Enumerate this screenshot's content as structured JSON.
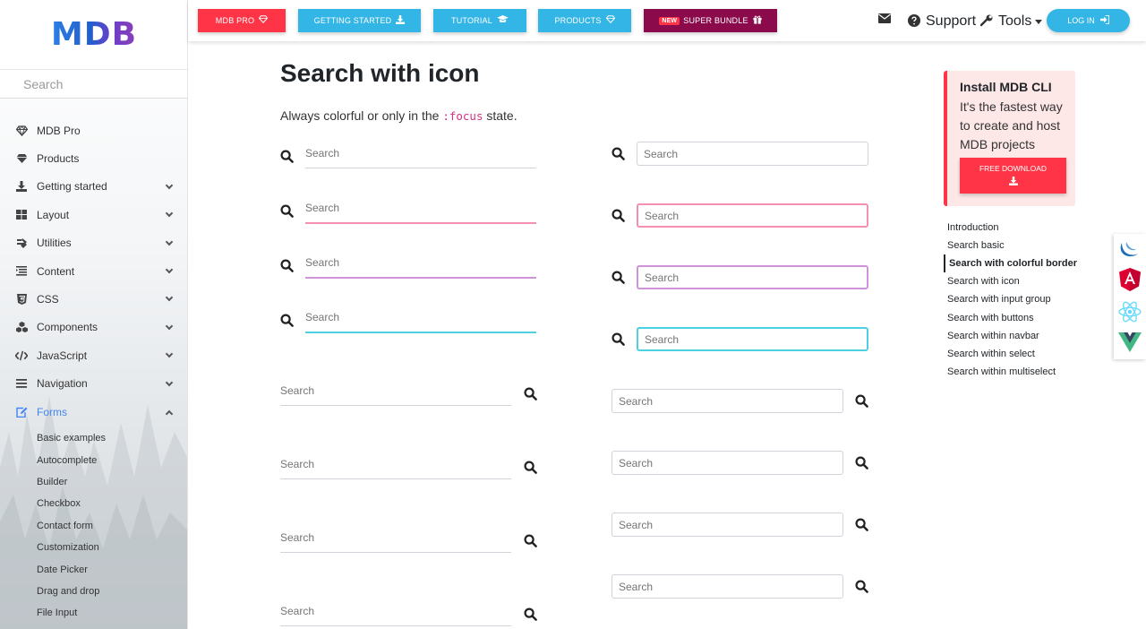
{
  "sidebar": {
    "logo": "MDB",
    "search_placeholder": "Search",
    "items": [
      {
        "label": "MDB Pro",
        "icon": "gem-icon",
        "chevron": false
      },
      {
        "label": "Products",
        "icon": "gem-icon",
        "chevron": false
      },
      {
        "label": "Getting started",
        "icon": "download-icon",
        "chevron": true
      },
      {
        "label": "Layout",
        "icon": "grid-icon",
        "chevron": true
      },
      {
        "label": "Utilities",
        "icon": "tools-icon",
        "chevron": true
      },
      {
        "label": "Content",
        "icon": "list-icon",
        "chevron": true
      },
      {
        "label": "CSS",
        "icon": "css3-icon",
        "chevron": true
      },
      {
        "label": "Components",
        "icon": "cubes-icon",
        "chevron": true
      },
      {
        "label": "JavaScript",
        "icon": "code-icon",
        "chevron": true
      },
      {
        "label": "Navigation",
        "icon": "bars-icon",
        "chevron": true
      },
      {
        "label": "Forms",
        "icon": "edit-icon",
        "chevron": true
      }
    ],
    "sub_items": [
      "Basic examples",
      "Autocomplete",
      "Builder",
      "Checkbox",
      "Contact form",
      "Customization",
      "Date Picker",
      "Drag and drop",
      "File Input"
    ]
  },
  "topbar": {
    "buttons": [
      {
        "label": "MDB PRO",
        "icon": "gem-icon",
        "color": "#ff3547"
      },
      {
        "label": "GETTING STARTED",
        "icon": "download-icon",
        "color": "#33b5e5"
      },
      {
        "label": "TUTORIAL",
        "icon": "graduation-cap-icon",
        "color": "#33b5e5"
      },
      {
        "label": "PRODUCTS",
        "icon": "gem-icon",
        "color": "#33b5e5"
      },
      {
        "label": "SUPER BUNDLE",
        "badge": "NEW",
        "icon": "gift-icon",
        "color": "#8a0a4c"
      }
    ],
    "support_label": "Support",
    "tools_label": "Tools",
    "login_label": "LOG IN"
  },
  "main": {
    "title": "Search with icon",
    "subtitle_before": "Always colorful or only in the ",
    "subtitle_code": ":focus",
    "subtitle_after": " state.",
    "left_placeholder": "Search",
    "right_placeholder": "Search",
    "colors": {
      "pink": "#f48fb1",
      "purple": "#ce93d8",
      "cyan": "#4dd0e1",
      "grey": "#ced4da"
    }
  },
  "right": {
    "cli_title": "Install MDB CLI",
    "cli_desc": "It's the fastest way to create and host MDB projects",
    "cli_button": "FREE DOWNLOAD",
    "toc": [
      "Introduction",
      "Search basic",
      "Search with colorful border",
      "Search with icon",
      "Search with input group",
      "Search with buttons",
      "Search within navbar",
      "Search within select",
      "Search within multiselect"
    ],
    "toc_active": 2
  }
}
